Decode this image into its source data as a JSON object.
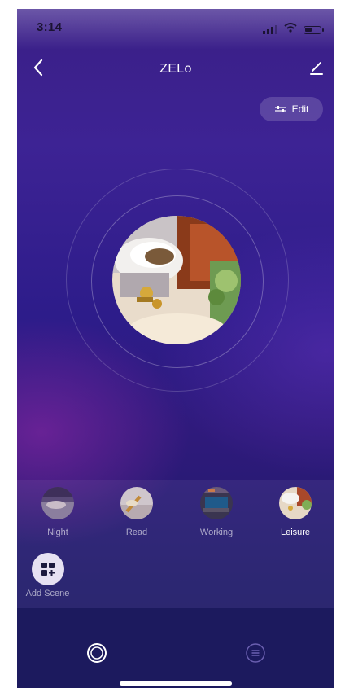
{
  "status_bar": {
    "time": "3:14"
  },
  "header": {
    "title": "ZELo"
  },
  "edit_button": {
    "label": "Edit"
  },
  "scenes": [
    {
      "label": "Night",
      "active": false
    },
    {
      "label": "Read",
      "active": false
    },
    {
      "label": "Working",
      "active": false
    },
    {
      "label": "Leisure",
      "active": true
    }
  ],
  "add_scene": {
    "label": "Add Scene"
  },
  "tabs": [
    {
      "icon": "scene-ring-icon",
      "selected": true
    },
    {
      "icon": "list-icon",
      "selected": false
    }
  ],
  "colors": {
    "background_top": "#3d2394",
    "background_bottom": "#1d1a62",
    "tabbar": "#1c1a5e",
    "label_inactive": "#a89fc8",
    "label_active": "#ffffff"
  }
}
